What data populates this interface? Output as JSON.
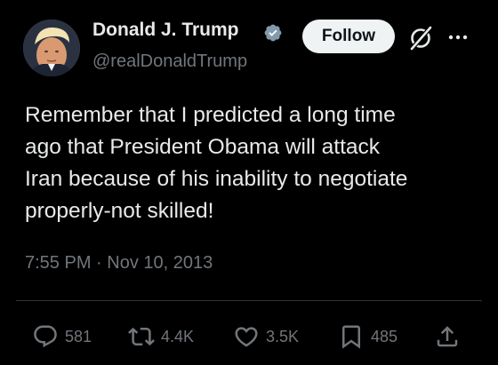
{
  "author": {
    "display_name": "Donald J. Trump",
    "handle": "@realDonaldTrump",
    "verified": true
  },
  "header": {
    "follow_label": "Follow",
    "grok_icon": "grok-icon",
    "more_icon": "more-dots-icon"
  },
  "tweet": {
    "text": "Remember that I predicted a long time\nago that President Obama will attack\nIran because of his inability to negotiate\nproperly-not skilled!",
    "timestamp": "7:55 PM · Nov 10, 2013"
  },
  "actions": {
    "replies": "581",
    "reposts": "4.4K",
    "likes": "3.5K",
    "bookmarks": "485"
  },
  "colors": {
    "background": "#000000",
    "text_primary": "#e7e9ea",
    "text_secondary": "#71767b",
    "verified_badge": "#829aab",
    "follow_button_bg": "#eff3f4"
  }
}
